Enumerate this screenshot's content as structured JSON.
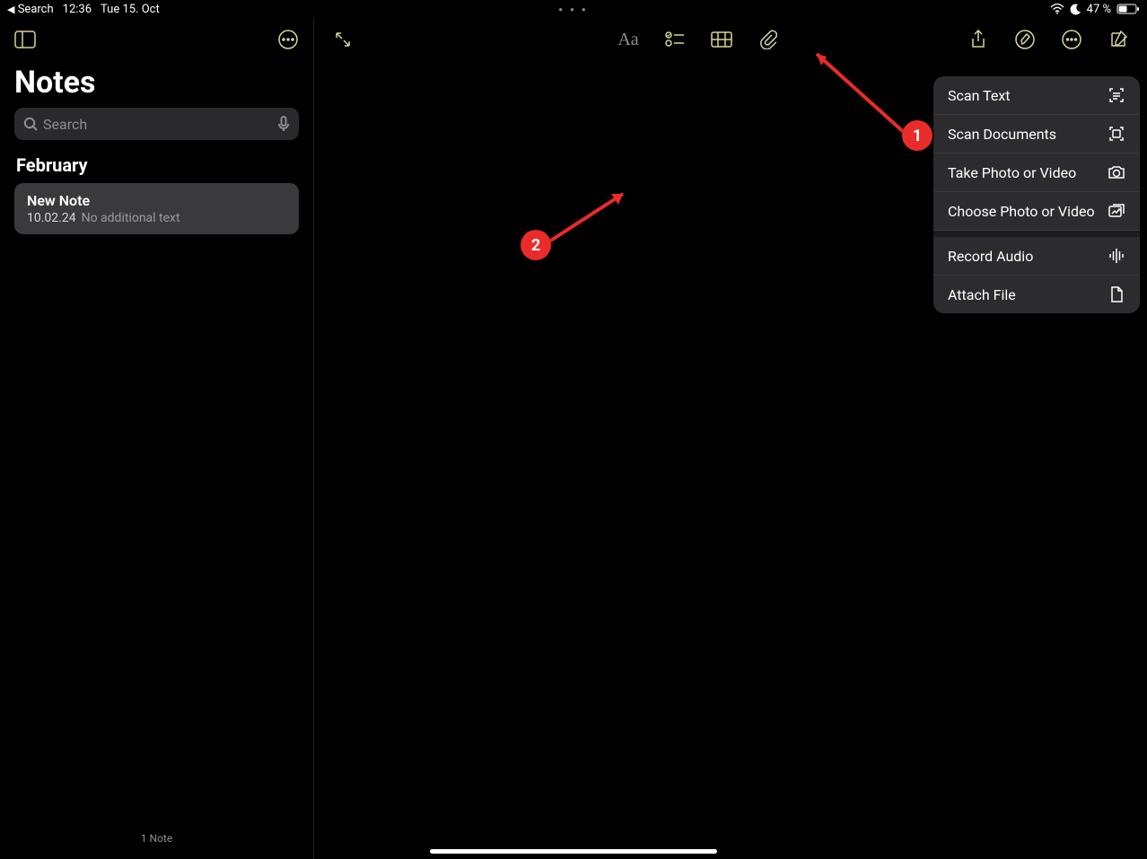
{
  "statusbar": {
    "back_label": "Search",
    "time": "12:36",
    "date": "Tue 15. Oct",
    "battery": "47 %"
  },
  "sidebar": {
    "title": "Notes",
    "search_placeholder": "Search",
    "section": "February",
    "note": {
      "title": "New Note",
      "date": "10.02.24",
      "preview": "No additional text"
    },
    "footer": "1 Note"
  },
  "popup": {
    "items": [
      {
        "label": "Scan Text"
      },
      {
        "label": "Scan Documents"
      },
      {
        "label": "Take Photo or Video"
      },
      {
        "label": "Choose Photo or Video"
      },
      {
        "label": "Record Audio"
      },
      {
        "label": "Attach File"
      }
    ]
  },
  "annotations": {
    "callout1": "1",
    "callout2": "2"
  }
}
